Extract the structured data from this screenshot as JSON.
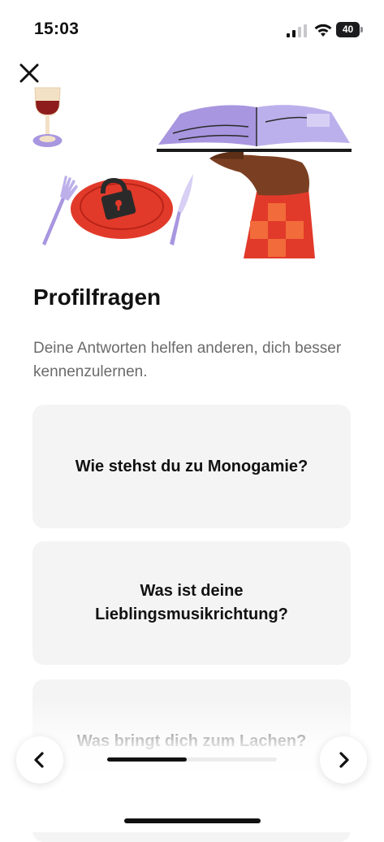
{
  "status_bar": {
    "time": "15:03",
    "battery_level": "40"
  },
  "header": {
    "close_icon": "close-icon"
  },
  "illustration": {
    "elements": [
      "wine-glass-icon",
      "fork-icon",
      "plate-icon",
      "padlock-icon",
      "knife-icon",
      "open-book-icon",
      "hand-icon"
    ]
  },
  "main": {
    "title": "Profilfragen",
    "subtitle": "Deine Antworten helfen anderen, dich besser kennenzulernen.",
    "questions": [
      {
        "label": "Wie stehst du zu Monogamie?"
      },
      {
        "label": "Was ist deine Lieblingsmusikrichtung?"
      },
      {
        "label": "Was bringt dich zum Lachen?"
      }
    ]
  },
  "footer": {
    "prev_icon": "chevron-left-icon",
    "next_icon": "chevron-right-icon",
    "progress": 0.47
  },
  "colors": {
    "card_background": "#f4f4f4",
    "subtitle": "#6b6b6b",
    "accent_red": "#e23a2a",
    "accent_purple": "#a896e0"
  }
}
